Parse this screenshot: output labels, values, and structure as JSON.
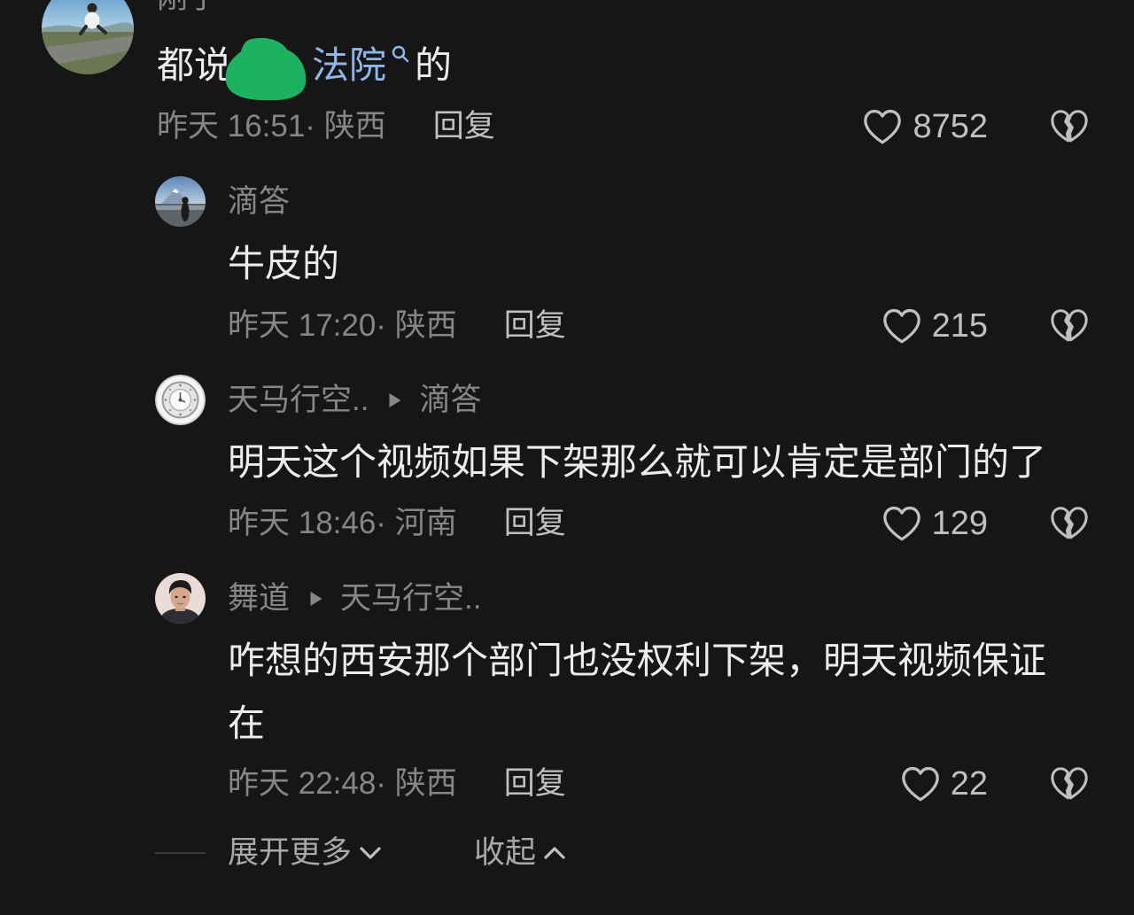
{
  "colors": {
    "bg": "#161616",
    "text_primary": "#ececec",
    "text_secondary": "#868686",
    "action": "#c0c0c0",
    "footer_text": "#a9a9a9",
    "link": "#8fb6e9",
    "redaction": "#1fb162",
    "divider": "#3a3a3a"
  },
  "icons": {
    "like": "heart-icon",
    "dislike": "broken-heart-icon",
    "search": "search-icon",
    "reply_to": "play-arrow-icon",
    "expand": "chevron-down-icon",
    "collapse": "chevron-up-icon"
  },
  "comment": {
    "author": "刚子",
    "text_prefix": "都说",
    "link_text": "法院",
    "text_suffix": "的",
    "timestamp": "昨天 16:51· 陕西",
    "reply_label": "回复",
    "like_count": "8752"
  },
  "replies": [
    {
      "author": "滴答",
      "text": "牛皮的",
      "timestamp": "昨天 17:20· 陕西",
      "reply_label": "回复",
      "like_count": "215"
    },
    {
      "author": "天马行空..",
      "reply_to": "滴答",
      "text": "明天这个视频如果下架那么就可以肯定是部门的了",
      "timestamp": "昨天 18:46· 河南",
      "reply_label": "回复",
      "like_count": "129"
    },
    {
      "author": "舞道",
      "reply_to": "天马行空..",
      "text": "咋想的西安那个部门也没权利下架，明天视频保证在",
      "timestamp": "昨天 22:48· 陕西",
      "reply_label": "回复",
      "like_count": "22"
    }
  ],
  "footer": {
    "expand_label": "展开更多",
    "collapse_label": "收起"
  }
}
